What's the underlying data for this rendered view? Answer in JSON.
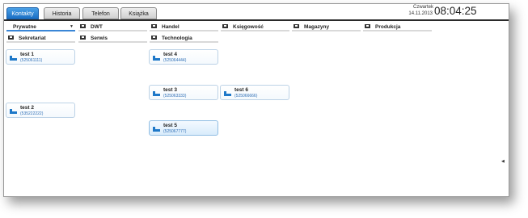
{
  "tabs": [
    {
      "label": "Kontakty",
      "active": true
    },
    {
      "label": "Historia",
      "active": false
    },
    {
      "label": "Telefon",
      "active": false
    },
    {
      "label": "Książka",
      "active": false
    }
  ],
  "clock": {
    "day": "Czwartek",
    "date": "14.11.2013",
    "time": "08:04:25"
  },
  "categories_row1": [
    {
      "label": "Prywatne",
      "type": "select"
    },
    {
      "label": "DWT",
      "type": "folder"
    },
    {
      "label": "Handel",
      "type": "folder"
    },
    {
      "label": "Księgowość",
      "type": "folder"
    },
    {
      "label": "Magazyny",
      "type": "folder"
    },
    {
      "label": "Produkcja",
      "type": "folder"
    }
  ],
  "categories_row2": [
    {
      "label": "Sekretariat",
      "type": "folder"
    },
    {
      "label": "Serwis",
      "type": "folder"
    },
    {
      "label": "Technologia",
      "type": "folder"
    }
  ],
  "contacts": [
    {
      "name": "test 1",
      "number": "(525061111)",
      "selected": false
    },
    {
      "name": "test 4",
      "number": "(525064444)",
      "selected": false
    },
    {
      "name": "test 3",
      "number": "(525063333)",
      "selected": false
    },
    {
      "name": "test 6",
      "number": "(525066666)",
      "selected": false
    },
    {
      "name": "test 2",
      "number": "(535222222)",
      "selected": false
    },
    {
      "name": "test 5",
      "number": "(525067777)",
      "selected": true
    }
  ],
  "icons": {
    "folder": "folder-icon",
    "contact": "contact-card-icon",
    "dropdown": "chevron-down-icon",
    "side_arrow": "chevron-left-icon"
  },
  "colors": {
    "accent": "#1b6fc4",
    "number_text": "#2f6fb6",
    "card_border": "#bcd2e6"
  }
}
